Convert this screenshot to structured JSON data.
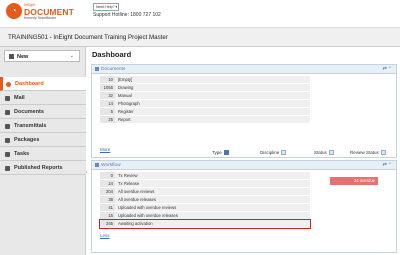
{
  "header": {
    "logo": {
      "top": "InEight",
      "main": "DOCUMENT",
      "sub": "formerly TeamBinder"
    },
    "help_label": "Need Help? ▾",
    "hotline": "Support Hotline: 1800 727 102"
  },
  "project": {
    "title": "TRAINING501 - InEight Document Training Project Master"
  },
  "sidebar": {
    "new_label": "New",
    "items": [
      {
        "label": "Dashboard",
        "active": true
      },
      {
        "label": "Mail"
      },
      {
        "label": "Documents"
      },
      {
        "label": "Transmittals"
      },
      {
        "label": "Packages"
      },
      {
        "label": "Tasks"
      },
      {
        "label": "Published Reports"
      }
    ],
    "collapse_icon": "‹"
  },
  "main": {
    "title": "Dashboard",
    "documents": {
      "title": "Documents",
      "controls": "⇄ ⌃",
      "rows": [
        {
          "count": "10",
          "label": "[Empty]"
        },
        {
          "count": "1055",
          "label": "Drawing"
        },
        {
          "count": "32",
          "label": "Manual"
        },
        {
          "count": "14",
          "label": "Photograph"
        },
        {
          "count": "5",
          "label": "Register"
        },
        {
          "count": "25",
          "label": "Report"
        }
      ],
      "more": "More",
      "filters": {
        "type": "Type",
        "discipline": "Discipline",
        "status": "Status",
        "review_status": "Review Status"
      }
    },
    "workflow": {
      "title": "Workflow",
      "controls": "⇄ ⌃",
      "rows": [
        {
          "count": "0",
          "label": "Tx Review"
        },
        {
          "count": "24",
          "label": "Tx Release"
        },
        {
          "count": "204",
          "label": "All overdue reviews"
        },
        {
          "count": "38",
          "label": "All overdue releases"
        },
        {
          "count": "41",
          "label": "Uploaded with overdue reviews"
        },
        {
          "count": "15",
          "label": "Uploaded with overdue releases"
        },
        {
          "count": "345",
          "label": "Awaiting activation"
        }
      ],
      "overdue_badge": "24 overdue",
      "less": "Less"
    }
  }
}
